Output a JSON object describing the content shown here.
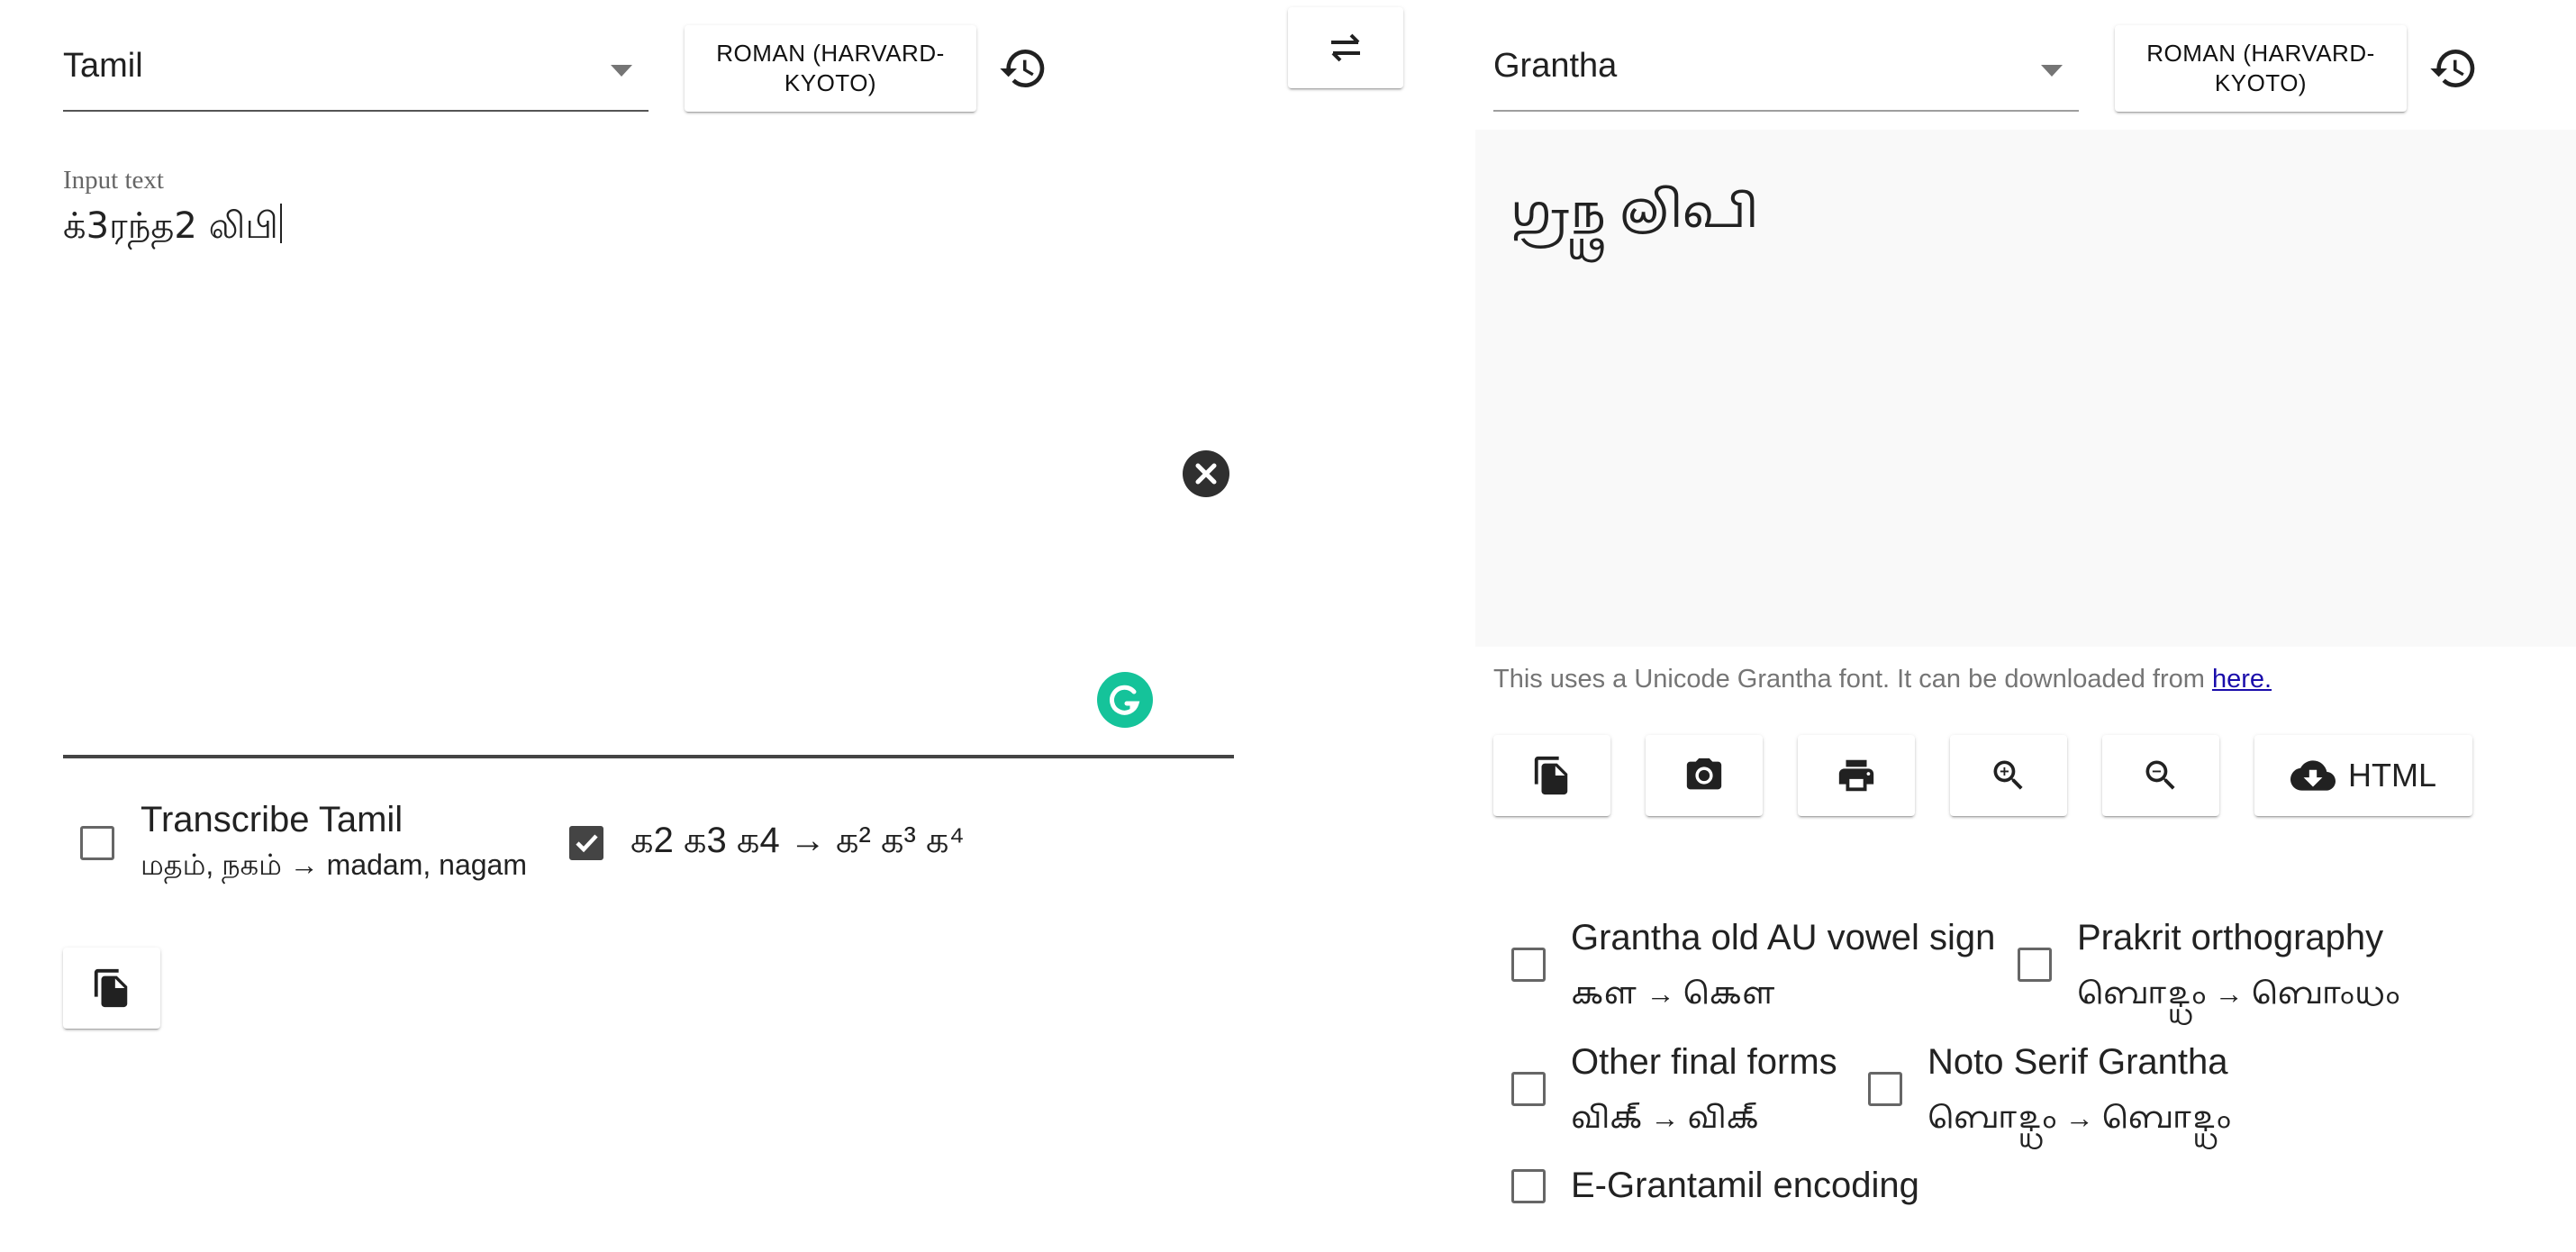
{
  "left": {
    "source_script": "Tamil",
    "scheme_button": "ROMAN (HARVARD-KYOTO)",
    "input_label": "Input text",
    "input_value": "க்3ரந்த2 லிபி",
    "options": [
      {
        "title": "Transcribe Tamil",
        "subtitle": "மதம், நகம் → madam, nagam",
        "checked": false
      },
      {
        "title": "க2 க3 க4 → க² க³ க⁴",
        "subtitle": "",
        "checked": true
      }
    ]
  },
  "swap_button": "swap-icon",
  "right": {
    "target_script": "Grantha",
    "scheme_button": "ROMAN (HARVARD-KYOTO)",
    "output_value": "𑌗𑍍𑌰𑌨𑍍𑌥 𑌲𑌿𑌪𑌿",
    "font_note": "This uses a Unicode Grantha font. It can be downloaded from ",
    "font_link": "here.",
    "html_button": "HTML",
    "options": [
      {
        "title": "Grantha old AU vowel sign",
        "subtitle": "𑌕𑍗 → 𑌕𑍌",
        "checked": false
      },
      {
        "title": "Prakrit orthography",
        "subtitle": "𑌬𑍋𑌦𑍍𑌧𑌂 → 𑌬𑍋𑌂𑌧𑌂",
        "checked": false
      },
      {
        "title": "Other final forms",
        "subtitle": "𑌵𑌿𑌕𑍍 → 𑌵𑌿𑌕𑍍",
        "checked": false
      },
      {
        "title": "Noto Serif Grantha",
        "subtitle": "𑌬𑍋𑌦𑍍𑌧𑌂 → 𑌬𑍋𑌦𑍍𑌧𑌂",
        "checked": false
      },
      {
        "title": "E-Grantamil encoding",
        "subtitle": "",
        "checked": false
      }
    ]
  },
  "colors": {
    "grammarly": "#15c39a",
    "link": "#1a0dab",
    "output_bg": "#f9f9f9"
  }
}
